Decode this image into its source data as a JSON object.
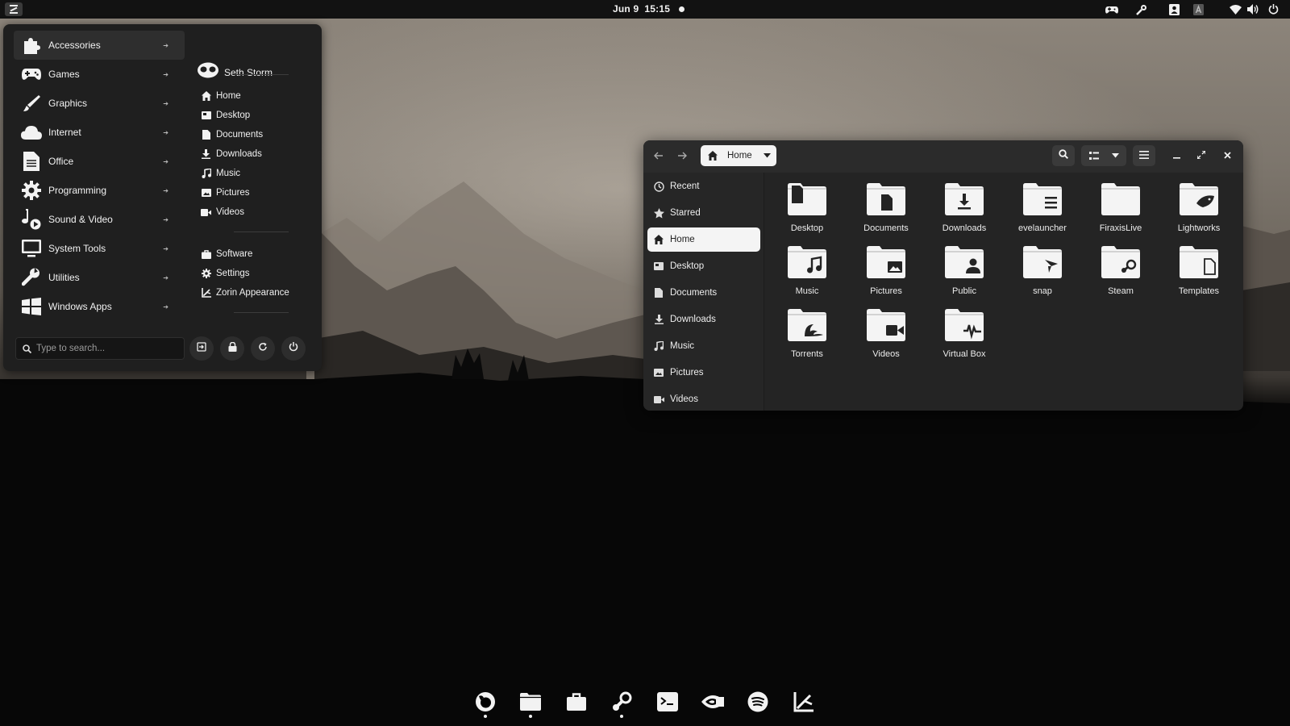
{
  "topbar": {
    "date": "Jun 9",
    "time": "15:15"
  },
  "start_menu": {
    "categories": [
      {
        "label": "Accessories",
        "icon": "puzzle-icon"
      },
      {
        "label": "Games",
        "icon": "gamepad-icon"
      },
      {
        "label": "Graphics",
        "icon": "brush-icon"
      },
      {
        "label": "Internet",
        "icon": "cloud-icon"
      },
      {
        "label": "Office",
        "icon": "document-icon"
      },
      {
        "label": "Programming",
        "icon": "gear-icon"
      },
      {
        "label": "Sound & Video",
        "icon": "music-icon"
      },
      {
        "label": "System Tools",
        "icon": "monitor-icon"
      },
      {
        "label": "Utilities",
        "icon": "wrench-icon"
      },
      {
        "label": "Windows Apps",
        "icon": "windows-icon"
      }
    ],
    "active_category": "Accessories",
    "user_name": "Seth Storm",
    "places": [
      {
        "label": "Home",
        "icon": "home-icon"
      },
      {
        "label": "Desktop",
        "icon": "desktop-icon"
      },
      {
        "label": "Documents",
        "icon": "document-icon"
      },
      {
        "label": "Downloads",
        "icon": "download-icon"
      },
      {
        "label": "Music",
        "icon": "music-icon"
      },
      {
        "label": "Pictures",
        "icon": "picture-icon"
      },
      {
        "label": "Videos",
        "icon": "video-icon"
      }
    ],
    "system": [
      {
        "label": "Software",
        "icon": "bag-icon"
      },
      {
        "label": "Settings",
        "icon": "gear-icon"
      },
      {
        "label": "Zorin Appearance",
        "icon": "appearance-icon"
      }
    ],
    "search_placeholder": "Type to search..."
  },
  "file_manager": {
    "path": "Home",
    "sidebar": [
      {
        "label": "Recent",
        "icon": "clock-icon"
      },
      {
        "label": "Starred",
        "icon": "star-icon"
      },
      {
        "label": "Home",
        "icon": "home-icon"
      },
      {
        "label": "Desktop",
        "icon": "desktop-icon"
      },
      {
        "label": "Documents",
        "icon": "document-icon"
      },
      {
        "label": "Downloads",
        "icon": "download-icon"
      },
      {
        "label": "Music",
        "icon": "music-icon"
      },
      {
        "label": "Pictures",
        "icon": "picture-icon"
      },
      {
        "label": "Videos",
        "icon": "video-icon"
      }
    ],
    "active_sidebar": "Home",
    "folders": [
      {
        "label": "Desktop",
        "emblem": "desktop"
      },
      {
        "label": "Documents",
        "emblem": "document"
      },
      {
        "label": "Downloads",
        "emblem": "download"
      },
      {
        "label": "evelauncher",
        "emblem": "list"
      },
      {
        "label": "FiraxisLive",
        "emblem": "none"
      },
      {
        "label": "Lightworks",
        "emblem": "shark"
      },
      {
        "label": "Music",
        "emblem": "music"
      },
      {
        "label": "Pictures",
        "emblem": "picture"
      },
      {
        "label": "Public",
        "emblem": "person"
      },
      {
        "label": "snap",
        "emblem": "snap"
      },
      {
        "label": "Steam",
        "emblem": "steam"
      },
      {
        "label": "Templates",
        "emblem": "template"
      },
      {
        "label": "Torrents",
        "emblem": "wave"
      },
      {
        "label": "Videos",
        "emblem": "video"
      },
      {
        "label": "Virtual Box",
        "emblem": "pulse"
      }
    ]
  },
  "dock": {
    "apps": [
      {
        "name": "firefox-icon",
        "running": true
      },
      {
        "name": "files-icon",
        "running": true
      },
      {
        "name": "software-icon",
        "running": false
      },
      {
        "name": "steam-icon",
        "running": true
      },
      {
        "name": "terminal-icon",
        "running": false
      },
      {
        "name": "nvidia-icon",
        "running": false
      },
      {
        "name": "spotify-icon",
        "running": false
      },
      {
        "name": "zorin-appearance-icon",
        "running": false
      }
    ]
  },
  "colors": {
    "panel_bg": "#1f1f1f",
    "topbar_bg": "#121212",
    "window_bg": "#242424",
    "active_item_bg": "#f4f4f4",
    "text": "#f2f2f2"
  }
}
